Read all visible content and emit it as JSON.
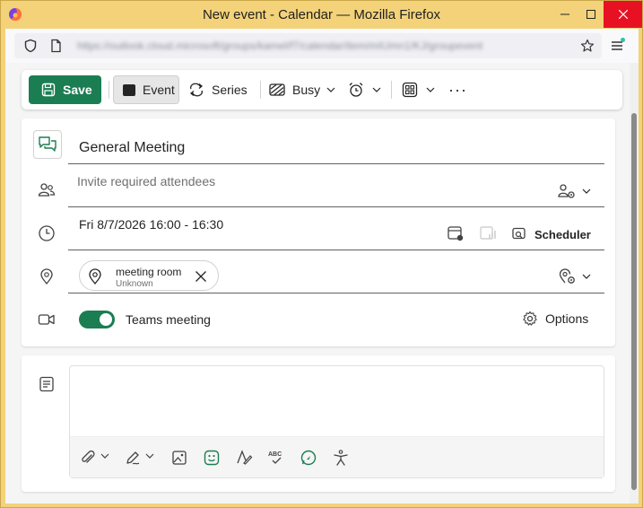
{
  "window": {
    "title": "New event - Calendar — Mozilla Firefox",
    "url": "https://outlook.cloud.microsoft/groups/kamel/f7/calendar/item/mIUmn1/KJ/groupevent"
  },
  "toolbar": {
    "save_label": "Save",
    "event_label": "Event",
    "series_label": "Series",
    "busy_label": "Busy",
    "more_label": "···"
  },
  "event": {
    "title": "General Meeting",
    "attendees_placeholder": "Invite required attendees",
    "datetime": "Fri 8/7/2026 16:00 - 16:30",
    "scheduler_label": "Scheduler",
    "location": {
      "name": "meeting room",
      "status": "Unknown"
    },
    "teams_label": "Teams meeting",
    "teams_enabled": true,
    "options_label": "Options"
  },
  "colors": {
    "accent": "#1b7d52",
    "titlebar": "#f3d27a",
    "close": "#e81123"
  }
}
